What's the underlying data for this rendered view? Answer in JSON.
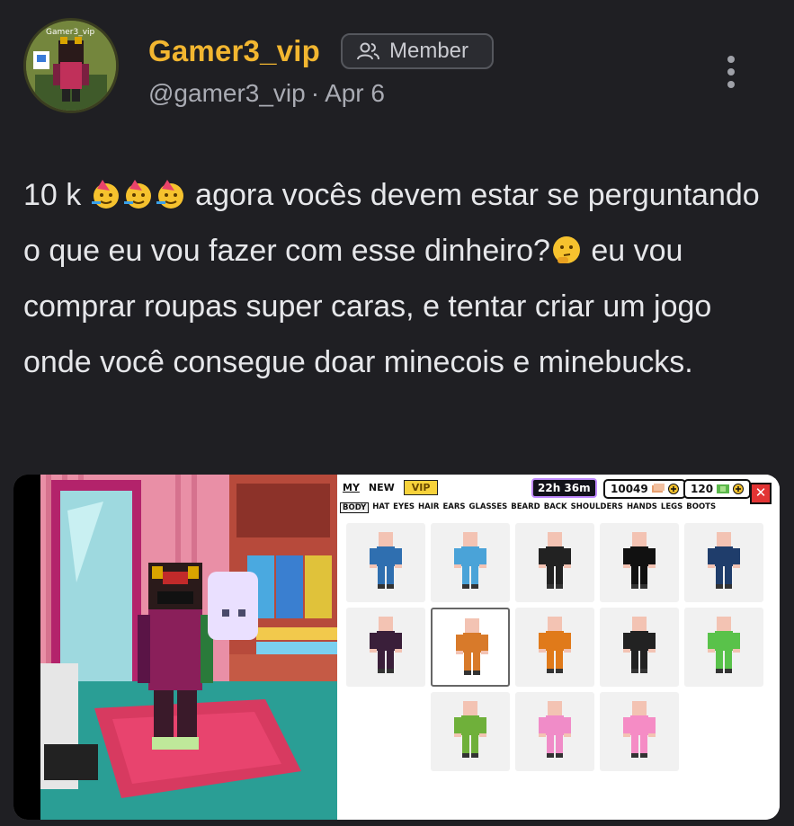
{
  "post": {
    "author": {
      "display_name": "Gamer3_vip",
      "handle": "@gamer3_vip",
      "avatar_tag": "Gamer3_vip",
      "badge": "Member",
      "badge_icon": "users-icon"
    },
    "separator": "·",
    "date": "Apr 6",
    "menu_icon": "more-vertical-icon",
    "text_parts": {
      "p1": "10 k",
      "p2": "agora vocês devem estar se perguntando o que eu vou fazer com esse dinheiro?",
      "p3": "eu vou comprar roupas super caras, e tentar criar um jogo onde você consegue doar minecois e minebucks."
    },
    "emojis": [
      "partying-face-emoji",
      "partying-face-emoji",
      "partying-face-emoji",
      "thinking-face-emoji"
    ]
  },
  "shop": {
    "tabs": [
      "MY",
      "NEW",
      "VIP"
    ],
    "timer": "22h 36m",
    "coins": "10049",
    "bucks": "120",
    "close_icon": "close-icon",
    "close_label": "✕",
    "categories": [
      "BODY",
      "HAT",
      "EYES",
      "HAIR",
      "EARS",
      "GLASSES",
      "BEARD",
      "BACK",
      "SHOULDERS",
      "HANDS",
      "LEGS",
      "BOOTS"
    ],
    "selected_category": "BODY",
    "outfit_colors": [
      "#2f6fb0",
      "#4aa3d8",
      "#222222",
      "#111111",
      "#1f3d6b",
      "#3a1f3a",
      "#d87a2a",
      "#e07a1a",
      "#222222",
      "#59c24a",
      "#6fb03a",
      "#f08cc8",
      "#f58cc5"
    ],
    "selected_item": 6
  }
}
